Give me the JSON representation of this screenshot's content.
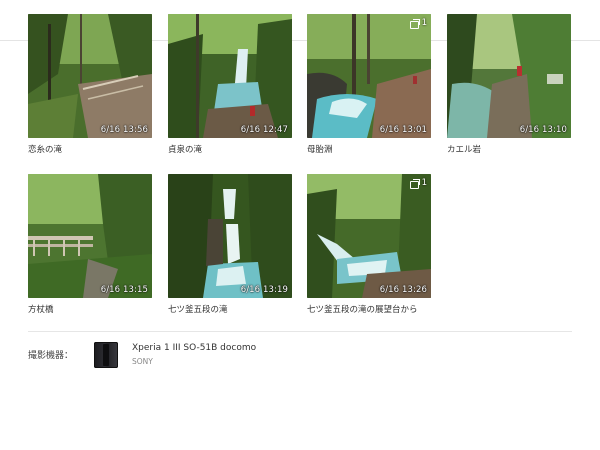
{
  "photos": [
    {
      "caption": "恋糸の滝",
      "time": "6/16 13:56",
      "badge": ""
    },
    {
      "caption": "貞泉の滝",
      "time": "6/16 12:47",
      "badge": ""
    },
    {
      "caption": "母胎淵",
      "time": "6/16 13:01",
      "badge": "1"
    },
    {
      "caption": "カエル岩",
      "time": "6/16 13:10",
      "badge": ""
    },
    {
      "caption": "方杖橋",
      "time": "6/16 13:15",
      "badge": ""
    },
    {
      "caption": "七ツ釜五段の滝",
      "time": "6/16 13:19",
      "badge": ""
    },
    {
      "caption": "七ツ釜五段の滝の展望台から",
      "time": "6/16 13:26",
      "badge": "1"
    }
  ],
  "device": {
    "label": "撮影機器：",
    "model": "Xperia 1 III SO-51B docomo",
    "maker": "SONY"
  },
  "colors": {
    "foliage_dark": "#2f4a1f",
    "foliage_light": "#7ba04a",
    "water": "#8fd6dd",
    "rock": "#8a7a68"
  }
}
